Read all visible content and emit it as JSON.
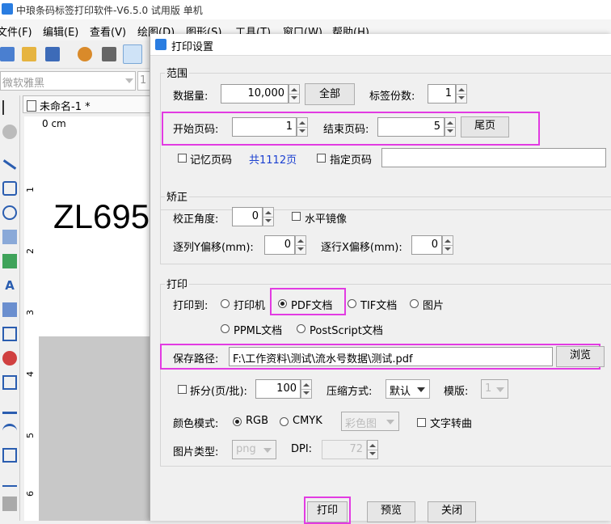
{
  "app": {
    "title": "中琅条码标签打印软件-V6.5.0 试用版 单机",
    "menu": [
      "文件(F)",
      "编辑(E)",
      "查看(V)",
      "绘图(D)",
      "图形(S)",
      "工具(T)",
      "窗口(W)",
      "帮助(H)"
    ],
    "font_name": "微软雅黑",
    "font_size": "1",
    "document_tab": "未命名-1 *",
    "ruler_unit": "0 cm",
    "ruler_ticks_left": [
      "1",
      "2",
      "3",
      "4",
      "5",
      "6"
    ],
    "label_text": "ZL695"
  },
  "dialog": {
    "title": "打印设置",
    "range": {
      "group_label": "范围",
      "quantity_label": "数据量:",
      "quantity_value": "10,000",
      "all_button": "全部",
      "copies_label": "标签份数:",
      "copies_value": "1",
      "start_page_label": "开始页码:",
      "start_page_value": "1",
      "end_page_label": "结束页码:",
      "end_page_value": "5",
      "last_page_button": "尾页",
      "remember_page_label": "记忆页码",
      "total_pages": "共1112页",
      "specify_page_label": "指定页码",
      "specify_page_value": ""
    },
    "correction": {
      "group_label": "矫正",
      "angle_label": "校正角度:",
      "angle_value": "0",
      "mirror_label": "水平镜像",
      "col_y_label": "逐列Y偏移(mm):",
      "col_y_value": "0",
      "row_x_label": "逐行X偏移(mm):",
      "row_x_value": "0"
    },
    "print": {
      "group_label": "打印",
      "print_to_label": "打印到:",
      "targets": [
        "打印机",
        "PDF文档",
        "TIF文档",
        "图片",
        "PPML文档",
        "PostScript文档"
      ],
      "selected_target": "PDF文档",
      "save_path_label": "保存路径:",
      "save_path_value": "F:\\工作资料\\测试\\流水号数据\\测试.pdf",
      "browse_button": "浏览",
      "split_label": "拆分(页/批):",
      "split_value": "100",
      "compression_label": "压缩方式:",
      "compression_value": "默认",
      "template_label": "模版:",
      "template_value": "1",
      "color_mode_label": "颜色模式:",
      "rgb_label": "RGB",
      "cmyk_label": "CMYK",
      "color_combo_value": "彩色图",
      "text_convert_label": "文字转曲",
      "image_type_label": "图片类型:",
      "image_type_value": "png",
      "dpi_label": "DPI:",
      "dpi_value": "72"
    },
    "buttons": {
      "print": "打印",
      "preview": "预览",
      "close": "关闭"
    },
    "colors": {
      "highlight": "#e23be2",
      "link": "#1a3fd0"
    }
  }
}
